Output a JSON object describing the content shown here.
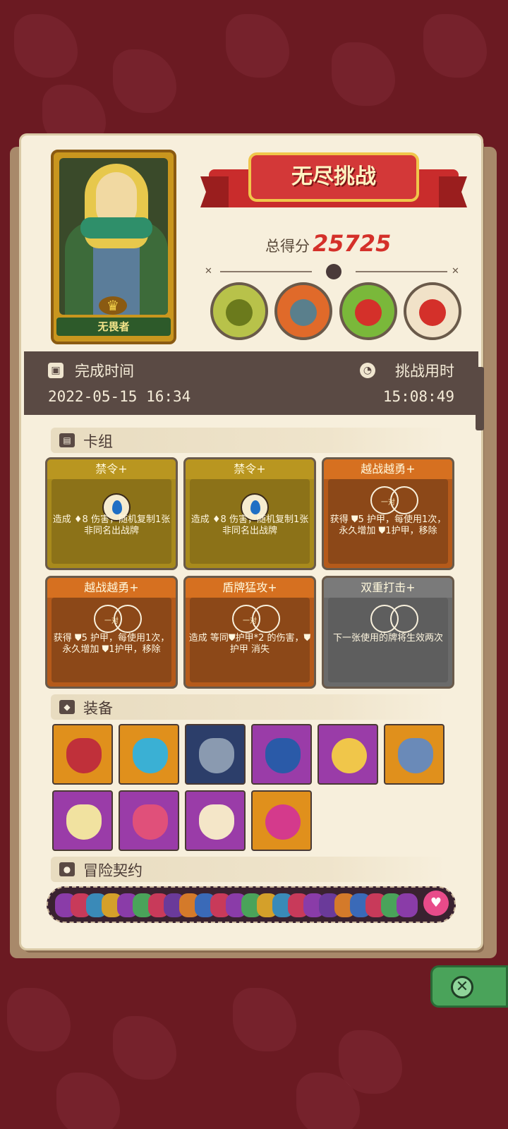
{
  "hero": {
    "name": "无畏者",
    "crown_icon": "crown-icon"
  },
  "header": {
    "banner_title": "无尽挑战",
    "score_label": "总得分",
    "score_value": "25725"
  },
  "info": {
    "finish_time_label": "完成时间",
    "finish_time_value": "2022-05-15 16:34",
    "duration_label": "挑战用时",
    "duration_value": "15:08:49"
  },
  "deck": {
    "section_label": "卡组",
    "cards": [
      {
        "title": "禁令+",
        "color": "gold",
        "icon": "water-drop-icon",
        "pair": "",
        "desc": "造成 ♦8 伤害，随机复制1张非同名出战牌"
      },
      {
        "title": "禁令+",
        "color": "gold",
        "icon": "water-drop-icon",
        "pair": "",
        "desc": "造成 ♦8 伤害，随机复制1张非同名出战牌"
      },
      {
        "title": "越战越勇+",
        "color": "orange",
        "icon": "double-ring-icon",
        "pair": "一对",
        "desc": "获得 ⛊5 护甲，每使用1次，永久增加 ⛊1护甲，移除"
      },
      {
        "title": "越战越勇+",
        "color": "orange",
        "icon": "double-ring-icon",
        "pair": "一对",
        "desc": "获得 ⛊5 护甲，每使用1次，永久增加 ⛊1护甲，移除"
      },
      {
        "title": "盾牌猛攻+",
        "color": "orange",
        "icon": "double-ring-icon",
        "pair": "一对",
        "desc": "造成 等同⛊护甲*2 的伤害，⛊护甲 消失"
      },
      {
        "title": "双重打击+",
        "color": "gray",
        "icon": "double-ring-icon",
        "pair": "",
        "desc": "下一张使用的牌将生效两次"
      }
    ]
  },
  "equipment": {
    "section_label": "装备",
    "items": [
      {
        "icon": "shell-armor-icon",
        "bg": "orange"
      },
      {
        "icon": "shield-emblem-icon",
        "bg": "orange"
      },
      {
        "icon": "chest-armor-icon",
        "bg": "navy"
      },
      {
        "icon": "crest-shield-icon",
        "bg": "purple"
      },
      {
        "icon": "moon-star-icon",
        "bg": "purple"
      },
      {
        "icon": "horn-icon",
        "bg": "orange"
      },
      {
        "icon": "claw-icon",
        "bg": "purple"
      },
      {
        "icon": "mushroom-cap-icon",
        "bg": "purple"
      },
      {
        "icon": "spiked-egg-icon",
        "bg": "purple"
      },
      {
        "icon": "pink-orb-icon",
        "bg": "orange"
      }
    ]
  },
  "contracts": {
    "section_label": "冒险契约",
    "end_icon": "heart-lock-icon"
  },
  "bosses": [
    "dragon-skull-icon",
    "orc-demon-icon",
    "green-demon-icon",
    "fire-mask-icon"
  ],
  "close_icon": "close-icon"
}
